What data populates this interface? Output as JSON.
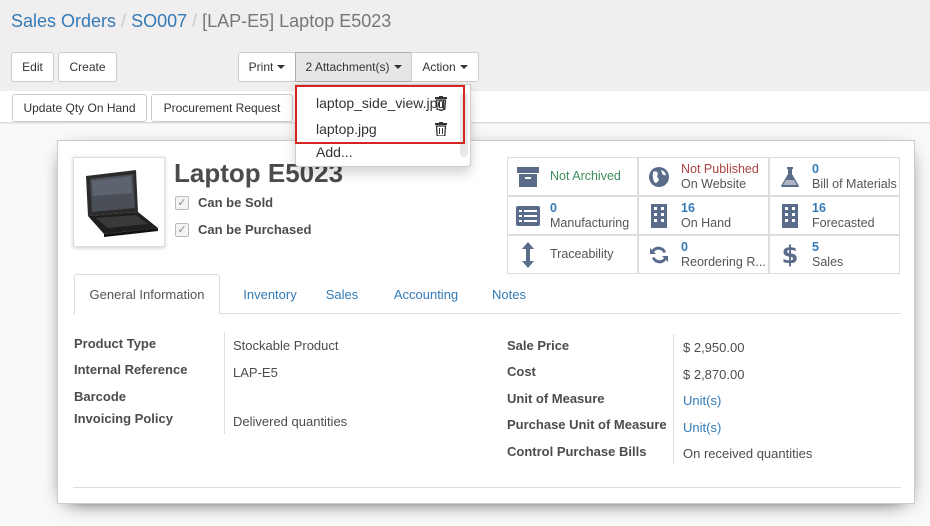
{
  "breadcrumb": {
    "item1": "Sales Orders",
    "item2": "SO007",
    "current": "[LAP-E5] Laptop E5023"
  },
  "buttons": {
    "edit": "Edit",
    "create": "Create",
    "print": "Print",
    "attachments": "2 Attachment(s)",
    "action": "Action"
  },
  "statusbar": {
    "update_qty": "Update Qty On Hand",
    "procurement": "Procurement Request"
  },
  "attachments_menu": {
    "items": [
      "laptop_side_view.jpg",
      "laptop.jpg"
    ],
    "add": "Add..."
  },
  "product": {
    "name": "Laptop E5023",
    "can_be_sold": "Can be Sold",
    "can_be_purchased": "Can be Purchased",
    "image_icon": "laptop-image"
  },
  "smart_buttons": {
    "archived": {
      "label": "Not Archived",
      "icon": "archive-icon",
      "color": "#3c8d5f"
    },
    "published": {
      "line1": "Not Published",
      "line2": "On Website",
      "icon": "globe-icon",
      "color": "#a94442"
    },
    "bom": {
      "num": "0",
      "label": "Bill of Materials",
      "icon": "flask-icon"
    },
    "manufacturing": {
      "num": "0",
      "label": "Manufacturing",
      "icon": "list-icon"
    },
    "on_hand": {
      "num": "16",
      "label": "On Hand",
      "icon": "building-icon"
    },
    "forecasted": {
      "num": "16",
      "label": "Forecasted",
      "icon": "building-icon"
    },
    "traceability": {
      "label": "Traceability",
      "icon": "arrows-v-icon"
    },
    "reordering": {
      "num": "0",
      "label": "Reordering R...",
      "icon": "refresh-icon"
    },
    "sales": {
      "num": "5",
      "label": "Sales",
      "icon": "dollar-icon"
    }
  },
  "tabs": [
    "General Information",
    "Inventory",
    "Sales",
    "Accounting",
    "Notes"
  ],
  "left_fields": {
    "product_type": {
      "label": "Product Type",
      "value": "Stockable Product"
    },
    "internal_ref": {
      "label": "Internal Reference",
      "value": "LAP-E5"
    },
    "barcode": {
      "label": "Barcode",
      "value": ""
    },
    "invoicing_policy": {
      "label": "Invoicing Policy",
      "value": "Delivered quantities"
    }
  },
  "right_fields": {
    "sale_price": {
      "label": "Sale Price",
      "value": "$ 2,950.00"
    },
    "cost": {
      "label": "Cost",
      "value": "$ 2,870.00"
    },
    "uom": {
      "label": "Unit of Measure",
      "value": "Unit(s)"
    },
    "purchase_uom": {
      "label": "Purchase Unit of Measure",
      "value": "Unit(s)"
    },
    "control_bills": {
      "label": "Control Purchase Bills",
      "value": "On received quantities"
    }
  },
  "colors": {
    "link": "#337ab7",
    "highlight": "#d42424",
    "icon": "#5b6b8a"
  }
}
